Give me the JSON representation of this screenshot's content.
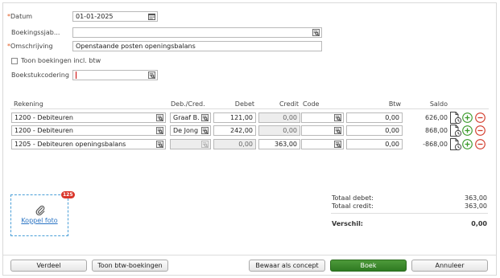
{
  "form": {
    "datum_label": "Datum",
    "datum_value": "01-01-2025",
    "boekingssjab_label": "Boekingssjab...",
    "boekingssjab_value": "",
    "omschrijving_label": "Omschrijving",
    "omschrijving_value": "Openstaande posten openingsbalans",
    "toon_btw_label": "Toon boekingen incl. btw",
    "toon_btw_checked": false,
    "boekstuk_label": "Boekstukcodering",
    "boekstuk_value": ""
  },
  "table": {
    "headers": {
      "rekening": "Rekening",
      "debcred": "Deb./Cred.",
      "debet": "Debet",
      "credit": "Credit",
      "code": "Code",
      "btw": "Btw",
      "saldo": "Saldo"
    },
    "rows": [
      {
        "rekening": "1200 - Debiteuren",
        "debcred": "Graaf B.",
        "debet": "121,00",
        "credit": "0,00",
        "code": "",
        "btw": "0,00",
        "saldo": "626,00"
      },
      {
        "rekening": "1200 - Debiteuren",
        "debcred": "De Jong",
        "debet": "242,00",
        "credit": "0,00",
        "code": "",
        "btw": "0,00",
        "saldo": "868,00"
      },
      {
        "rekening": "1205 - Debiteuren openingsbalans",
        "debcred": "",
        "debet": "0,00",
        "credit": "363,00",
        "code": "",
        "btw": "0,00",
        "saldo": "-868,00"
      }
    ]
  },
  "attachment": {
    "link_label": "Koppel foto",
    "badge_count": "125"
  },
  "totals": {
    "debet_label": "Totaal debet:",
    "debet_value": "363,00",
    "credit_label": "Totaal credit:",
    "credit_value": "363,00",
    "verschil_label": "Verschil:",
    "verschil_value": "0,00"
  },
  "buttons": {
    "verdeel": "Verdeel",
    "toon_btw": "Toon btw-boekingen",
    "concept": "Bewaar als concept",
    "boek": "Boek",
    "annuleer": "Annuleer"
  },
  "colors": {
    "accent_green": "#2f7a22",
    "required_orange": "#e05a20",
    "add_icon_green": "#3a9a2a",
    "remove_icon_red": "#d23a2a",
    "badge_red": "#d9362b",
    "link_blue": "#2a74c4"
  },
  "icons": {
    "lookup": "lookup-icon",
    "calendar": "calendar-icon",
    "document": "document-details-icon",
    "add": "add-row-icon",
    "remove": "remove-row-icon",
    "attach": "paperclip-icon"
  }
}
